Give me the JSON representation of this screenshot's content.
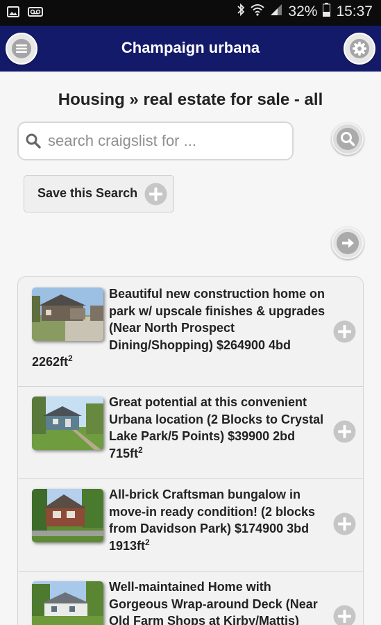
{
  "status_bar": {
    "battery": "32%",
    "time": "15:37"
  },
  "header": {
    "title": "Champaign urbana"
  },
  "page": {
    "title": "Housing » real estate for sale - all"
  },
  "search": {
    "placeholder": "search craigslist for ..."
  },
  "save_search": {
    "label": "Save this Search"
  },
  "listings": [
    {
      "title": "Beautiful new construction home on park w/ upscale finishes & upgrades (Near North Prospect Dining/Shopping) $264900 4bd 2262ft",
      "sup": "2"
    },
    {
      "title": "Great potential at this convenient Urbana location (2 Blocks to Crystal Lake Park/5 Points) $39900 2bd 715ft",
      "sup": "2"
    },
    {
      "title": "All-brick Craftsman bungalow in move-in ready condition! (2 blocks from Davidson Park) $174900 3bd 1913ft",
      "sup": "2"
    },
    {
      "title": "Well-maintained Home with Gorgeous Wrap-around Deck (Near Old Farm Shops at Kirby/Mattis)",
      "sup": ""
    }
  ]
}
